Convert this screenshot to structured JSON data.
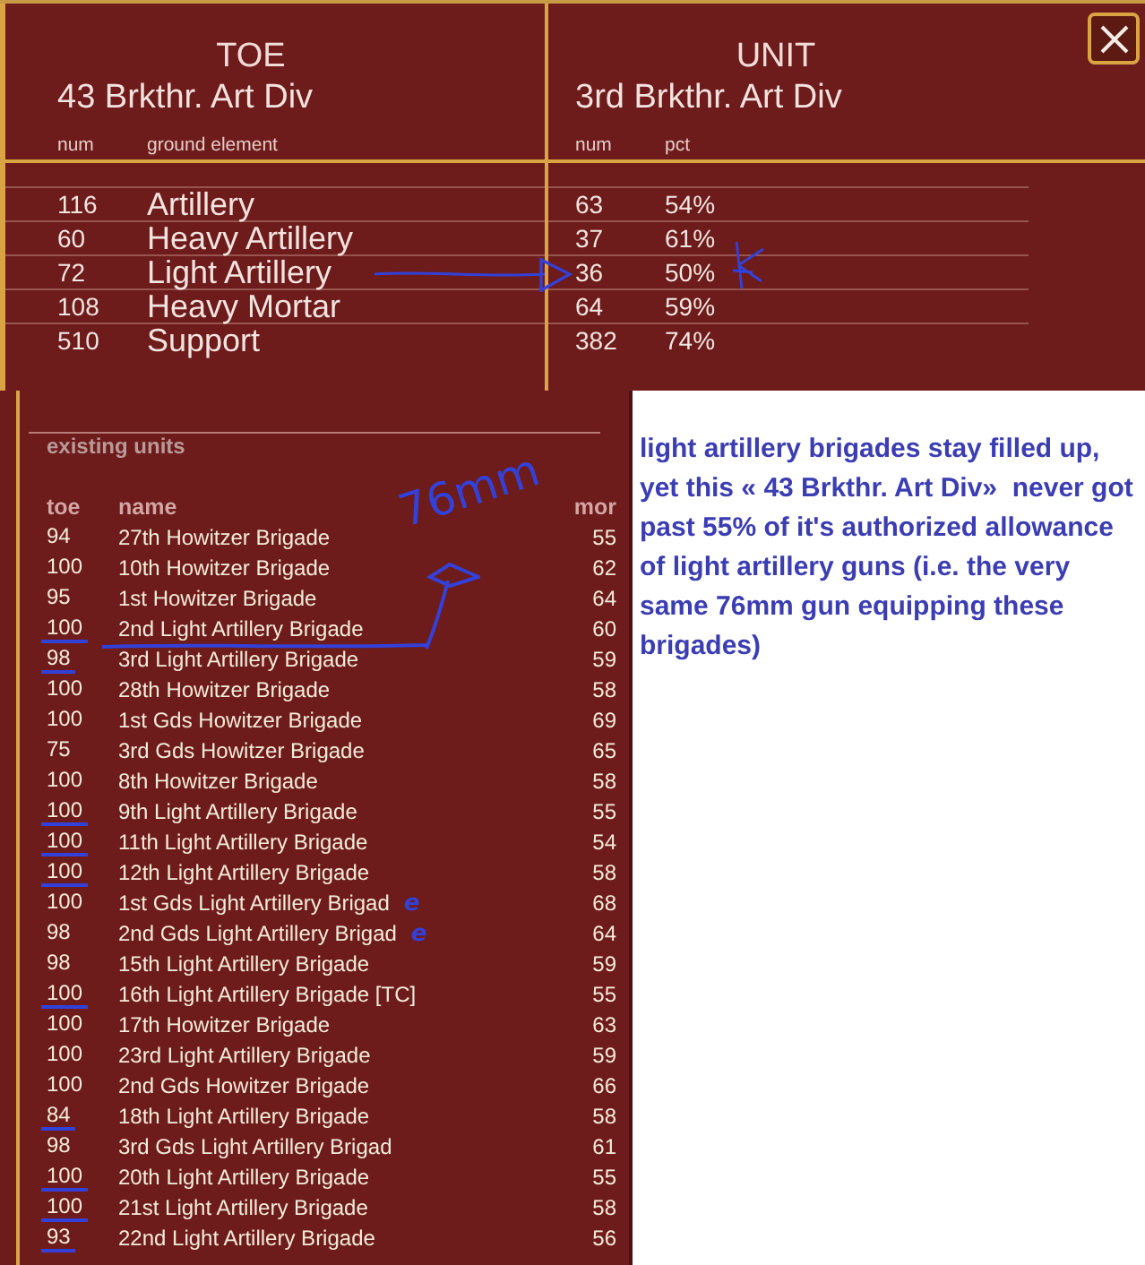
{
  "toe": {
    "title": "TOE",
    "unit_name": "43 Brkthr. Art Div",
    "columns": [
      "num",
      "ground element"
    ],
    "rows": [
      {
        "num": "116",
        "element": "Artillery"
      },
      {
        "num": "60",
        "element": "Heavy Artillery"
      },
      {
        "num": "72",
        "element": "Light Artillery"
      },
      {
        "num": "108",
        "element": "Heavy Mortar"
      },
      {
        "num": "510",
        "element": "Support"
      }
    ]
  },
  "unit": {
    "title": "UNIT",
    "unit_name": "3rd Brkthr. Art Div",
    "columns": [
      "num",
      "pct"
    ],
    "rows": [
      {
        "num": "63",
        "pct": "54%"
      },
      {
        "num": "37",
        "pct": "61%"
      },
      {
        "num": "36",
        "pct": "50%"
      },
      {
        "num": "64",
        "pct": "59%"
      },
      {
        "num": "382",
        "pct": "74%"
      }
    ]
  },
  "existing_units": {
    "title": "existing units",
    "columns": [
      "toe",
      "name",
      "mor"
    ],
    "rows": [
      {
        "toe": "94",
        "name": "27th Howitzer Brigade",
        "mor": "55",
        "marked": false
      },
      {
        "toe": "100",
        "name": "10th Howitzer Brigade",
        "mor": "62",
        "marked": false
      },
      {
        "toe": "95",
        "name": "1st Howitzer Brigade",
        "mor": "64",
        "marked": false
      },
      {
        "toe": "100",
        "name": "2nd Light Artillery Brigade",
        "mor": "60",
        "marked": true
      },
      {
        "toe": "98",
        "name": "3rd Light Artillery Brigade",
        "mor": "59",
        "marked": true
      },
      {
        "toe": "100",
        "name": "28th Howitzer Brigade",
        "mor": "58",
        "marked": false
      },
      {
        "toe": "100",
        "name": "1st Gds Howitzer Brigade",
        "mor": "69",
        "marked": false
      },
      {
        "toe": "75",
        "name": "3rd Gds Howitzer Brigade",
        "mor": "65",
        "marked": false
      },
      {
        "toe": "100",
        "name": "8th Howitzer Brigade",
        "mor": "58",
        "marked": false
      },
      {
        "toe": "100",
        "name": "9th Light Artillery Brigade",
        "mor": "55",
        "marked": true
      },
      {
        "toe": "100",
        "name": "11th Light Artillery Brigade",
        "mor": "54",
        "marked": true
      },
      {
        "toe": "100",
        "name": "12th Light Artillery Brigade",
        "mor": "58",
        "marked": true
      },
      {
        "toe": "100",
        "name": "1st Gds Light Artillery Brigad",
        "mor": "68",
        "marked": false,
        "note": "e"
      },
      {
        "toe": "98",
        "name": "2nd Gds Light Artillery Brigad",
        "mor": "64",
        "marked": false,
        "note": "e"
      },
      {
        "toe": "98",
        "name": "15th Light Artillery Brigade",
        "mor": "59",
        "marked": false
      },
      {
        "toe": "100",
        "name": "16th Light Artillery Brigade [TC]",
        "mor": "55",
        "marked": true
      },
      {
        "toe": "100",
        "name": "17th Howitzer Brigade",
        "mor": "63",
        "marked": false
      },
      {
        "toe": "100",
        "name": "23rd Light Artillery Brigade",
        "mor": "59",
        "marked": false
      },
      {
        "toe": "100",
        "name": "2nd Gds Howitzer Brigade",
        "mor": "66",
        "marked": false
      },
      {
        "toe": "84",
        "name": "18th Light Artillery Brigade",
        "mor": "58",
        "marked": true
      },
      {
        "toe": "98",
        "name": "3rd Gds Light Artillery Brigad",
        "mor": "61",
        "marked": false
      },
      {
        "toe": "100",
        "name": "20th Light Artillery Brigade",
        "mor": "55",
        "marked": true
      },
      {
        "toe": "100",
        "name": "21st Light Artillery Brigade",
        "mor": "58",
        "marked": true
      },
      {
        "toe": "93",
        "name": "22nd Light Artillery Brigade",
        "mor": "56",
        "marked": true
      }
    ]
  },
  "annotation": {
    "note": "light artillery brigades stay filled up, yet this « 43 Brkthr. Art Div»  never got past 55% of it's authorized allowance of light artillery guns (i.e. the very same 76mm gun equipping these brigades)",
    "handwriting": "76mm"
  }
}
